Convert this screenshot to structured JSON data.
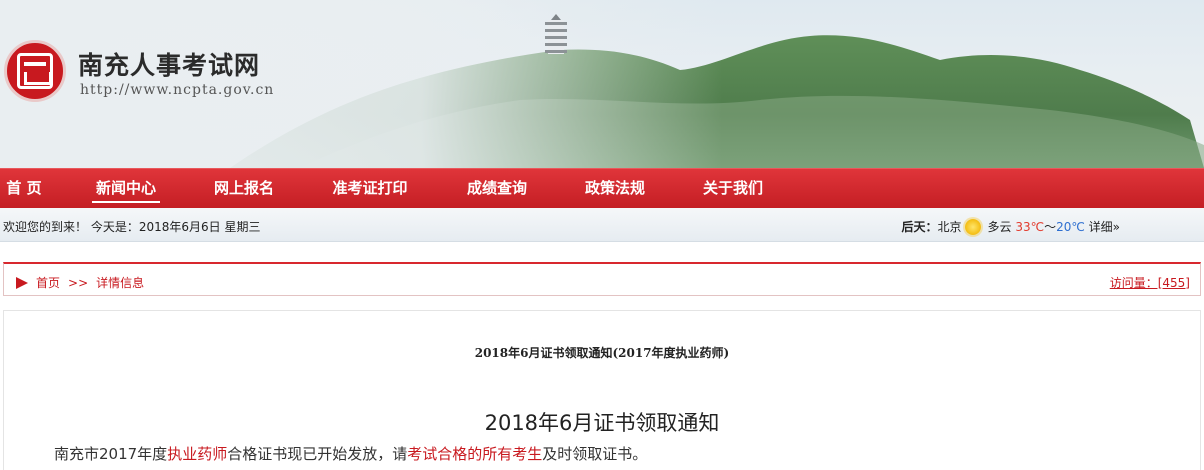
{
  "header": {
    "site_title": "南充人事考试网",
    "site_url": "http://www.ncpta.gov.cn"
  },
  "nav": {
    "items": [
      {
        "label": "首 页",
        "active": false
      },
      {
        "label": "新闻中心",
        "active": true
      },
      {
        "label": "网上报名",
        "active": false
      },
      {
        "label": "准考证打印",
        "active": false
      },
      {
        "label": "成绩查询",
        "active": false
      },
      {
        "label": "政策法规",
        "active": false
      },
      {
        "label": "关于我们",
        "active": false
      }
    ]
  },
  "infobar": {
    "welcome": "欢迎您的到来！ 今天是：2018年6月6日 星期三",
    "weather": {
      "day_label": "后天：",
      "city": "北京",
      "icon": "sun-icon",
      "condition": "多云",
      "temp_high": "33℃",
      "separator": "～",
      "temp_low": "20℃",
      "detail": "详细»"
    }
  },
  "breadcrumb": {
    "home": "首页",
    "separator": ">>",
    "current": "详情信息",
    "visits": "访问量：[455]"
  },
  "article": {
    "subtitle": "2018年6月证书领取通知(2017年度执业药师)",
    "title": "2018年6月证书领取通知",
    "paragraph": {
      "part1": "南充市2017年度",
      "highlight1": "执业药师",
      "part2": "合格证书现已开始发放，请",
      "highlight2": "考试合格的所有考生",
      "part3": "及时领取证书。"
    }
  },
  "colors": {
    "brand_red": "#c8191f",
    "nav_red": "#d8282e",
    "temp_high": "#e23b2e",
    "temp_low": "#2e6fd0"
  }
}
